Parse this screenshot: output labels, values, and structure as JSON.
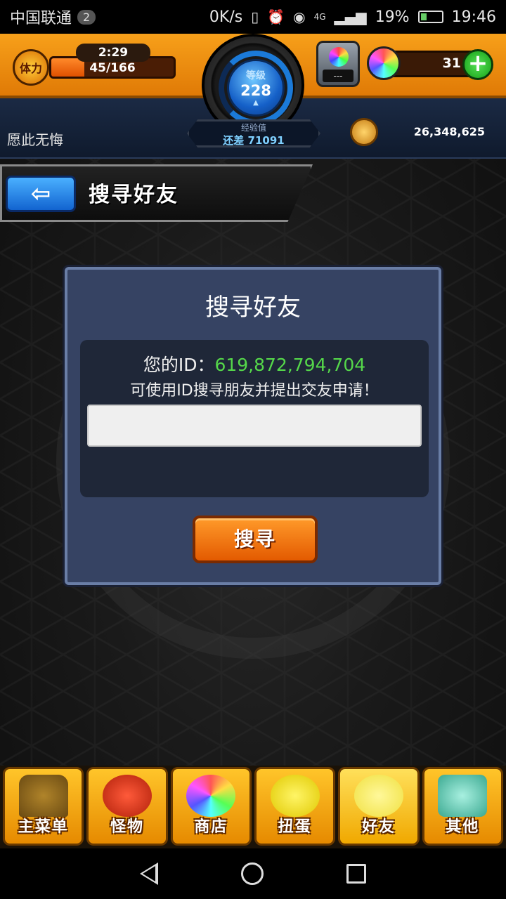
{
  "status_bar": {
    "carrier": "中国联通",
    "sim_badge": "2",
    "net_speed": "0K/s",
    "network_type": "4G",
    "battery_percent": "19%",
    "time": "19:46"
  },
  "hud": {
    "stamina_label": "体力",
    "stamina_timer": "2:29",
    "stamina_value": "45/166",
    "stamina_fraction": 0.27,
    "level_label": "等级",
    "level": "228",
    "exp_label": "经验值",
    "exp_remaining": "还差 71091",
    "player_name": "愿此无悔",
    "mailbox_text": "---",
    "gem_count": "31",
    "gem_add": "+",
    "coins": "26,348,625"
  },
  "header": {
    "back_icon": "back-arrow-icon",
    "title": "搜寻好友"
  },
  "dialog": {
    "title": "搜寻好友",
    "id_label": "您的ID：",
    "id_value": "619,872,794,704",
    "hint": "可使用ID搜寻朋友并提出交友申请！",
    "search_input_value": "",
    "search_button": "搜寻"
  },
  "tabs": [
    {
      "label": "主菜单",
      "icon": "home-gate-icon"
    },
    {
      "label": "怪物",
      "icon": "monster-icon"
    },
    {
      "label": "商店",
      "icon": "rainbow-orb-icon"
    },
    {
      "label": "扭蛋",
      "icon": "gacha-egg-icon"
    },
    {
      "label": "好友",
      "icon": "friends-balloons-icon"
    },
    {
      "label": "其他",
      "icon": "question-sign-icon"
    }
  ],
  "colors": {
    "hud_orange": "#f7a01a",
    "dialog_blue": "#364363",
    "id_green": "#55d84a",
    "button_orange": "#e35a00"
  }
}
